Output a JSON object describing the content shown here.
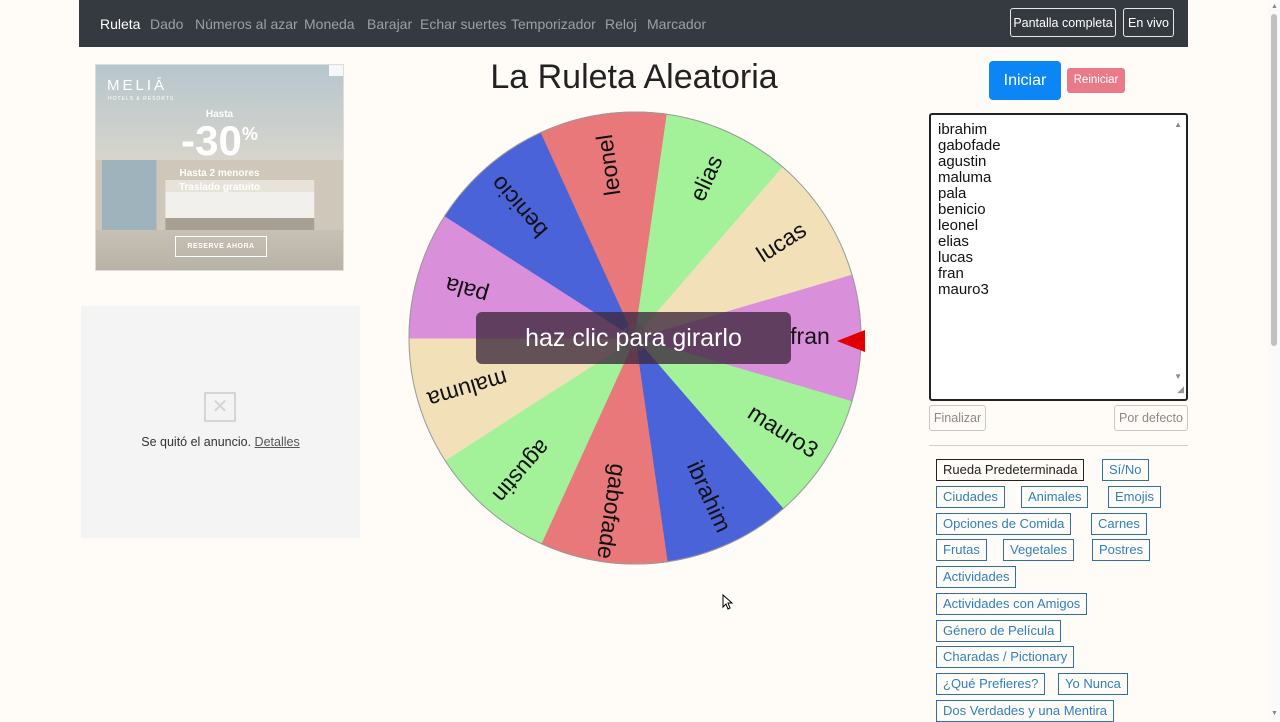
{
  "nav": {
    "links": [
      "Ruleta",
      "Dado",
      "Números al azar",
      "Moneda",
      "Barajar",
      "Echar suertes",
      "Temporizador",
      "Reloj",
      "Marcador"
    ],
    "fullscreen": "Pantalla completa",
    "live": "En vivo"
  },
  "ad": {
    "brand": "MELIĀ",
    "brand_sub": "HOTELS & RESORTS",
    "hasta": "Hasta",
    "discount": "-30",
    "percent": "%",
    "line1": "Hasta 2 menores",
    "line2": "Traslado gratuito",
    "cta": "RESERVE AHORA"
  },
  "removed_ad": {
    "text": "Se quitó el anuncio. ",
    "link": "Detalles"
  },
  "title": "La Ruleta Aleatoria",
  "spin_text": "haz clic para girarlo",
  "wheel": {
    "segments": [
      "fran",
      "mauro3",
      "ibrahim",
      "gabofade",
      "agustin",
      "maluma",
      "pala",
      "benicio",
      "leonel",
      "elias",
      "lucas"
    ],
    "colors": [
      "#d98fd9",
      "#a3f29a",
      "#4a63d9",
      "#e8787a",
      "#a3f29a",
      "#f2e0b8",
      "#d98fd9",
      "#4a63d9",
      "#e8787a",
      "#a3f29a",
      "#f2e0b8"
    ],
    "pointer_color": "#e00000"
  },
  "controls": {
    "start": "Iniciar",
    "reset": "Reiniciar",
    "finish": "Finalizar",
    "default": "Por defecto"
  },
  "names": [
    "ibrahim",
    "gabofade",
    "agustin",
    "maluma",
    "pala",
    "benicio",
    "leonel",
    "elias",
    "lucas",
    "fran",
    "mauro3"
  ],
  "presets": [
    "Rueda Predeterminada",
    "Sí/No",
    "Ciudades",
    "Animales",
    "Emojis",
    "Opciones de Comida",
    "Carnes",
    "Frutas",
    "Vegetales",
    "Postres",
    "Actividades",
    "Actividades con Amigos",
    "Género de Película",
    "Charadas / Pictionary",
    "¿Qué Prefieres?",
    "Yo Nunca",
    "Dos Verdades y una Mentira"
  ]
}
